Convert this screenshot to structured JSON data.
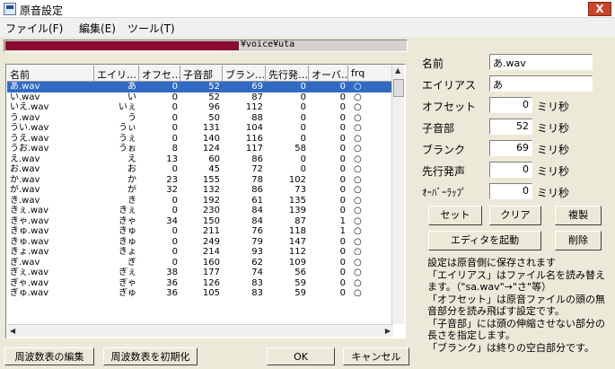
{
  "window": {
    "title": "原音設定",
    "close_label": "X"
  },
  "menu": [
    {
      "label": "ファイル(F)"
    },
    {
      "label": "編集(E)"
    },
    {
      "label": "ツール(T)"
    }
  ],
  "path": {
    "text": "¥voice¥uta",
    "accent": "#8b0a2e"
  },
  "table": {
    "headers": [
      "名前",
      "エイリ…",
      "オフセ…",
      "子音部",
      "ブラン…",
      "先行発…",
      "オーバ…",
      "frq"
    ],
    "rows": [
      [
        "あ.wav",
        "あ",
        "0",
        "52",
        "69",
        "0",
        "0",
        "○"
      ],
      [
        "い.wav",
        "い",
        "0",
        "52",
        "87",
        "0",
        "0",
        "○"
      ],
      [
        "いえ.wav",
        "いぇ",
        "0",
        "96",
        "112",
        "0",
        "0",
        "○"
      ],
      [
        "う.wav",
        "う",
        "0",
        "50",
        "88",
        "0",
        "0",
        "○"
      ],
      [
        "うい.wav",
        "うぃ",
        "0",
        "131",
        "104",
        "0",
        "0",
        "○"
      ],
      [
        "うえ.wav",
        "うぇ",
        "0",
        "140",
        "116",
        "0",
        "0",
        "○"
      ],
      [
        "うお.wav",
        "うぉ",
        "8",
        "124",
        "117",
        "58",
        "0",
        "○"
      ],
      [
        "え.wav",
        "え",
        "13",
        "60",
        "86",
        "0",
        "0",
        "○"
      ],
      [
        "お.wav",
        "お",
        "0",
        "45",
        "72",
        "0",
        "0",
        "○"
      ],
      [
        "か.wav",
        "か",
        "23",
        "155",
        "78",
        "102",
        "0",
        "○"
      ],
      [
        "が.wav",
        "が",
        "32",
        "132",
        "86",
        "73",
        "0",
        "○"
      ],
      [
        "き.wav",
        "き",
        "0",
        "192",
        "61",
        "135",
        "0",
        "○"
      ],
      [
        "きぇ.wav",
        "きぇ",
        "0",
        "230",
        "84",
        "139",
        "0",
        "○"
      ],
      [
        "きゃ.wav",
        "きゃ",
        "34",
        "150",
        "84",
        "87",
        "1",
        "○"
      ],
      [
        "きゅ.wav",
        "きゅ",
        "0",
        "211",
        "76",
        "118",
        "1",
        "○"
      ],
      [
        "きゅ.wav",
        "きゅ",
        "0",
        "249",
        "79",
        "147",
        "0",
        "○"
      ],
      [
        "きょ.wav",
        "きょ",
        "0",
        "214",
        "93",
        "112",
        "0",
        "○"
      ],
      [
        "ぎ.wav",
        "ぎ",
        "0",
        "160",
        "62",
        "109",
        "0",
        "○"
      ],
      [
        "ぎぇ.wav",
        "ぎぇ",
        "38",
        "177",
        "74",
        "56",
        "0",
        "○"
      ],
      [
        "ぎゃ.wav",
        "ぎゃ",
        "36",
        "126",
        "83",
        "59",
        "0",
        "○"
      ],
      [
        "ぎゅ.wav",
        "ぎゅ",
        "36",
        "105",
        "83",
        "59",
        "0",
        "○"
      ]
    ]
  },
  "form": {
    "name_label": "名前",
    "name_value": "あ.wav",
    "alias_label": "エイリアス",
    "alias_value": "あ",
    "offset_label": "オフセット",
    "offset_value": "0",
    "consonant_label": "子音部",
    "consonant_value": "52",
    "blank_label": "ブランク",
    "blank_value": "69",
    "preutter_label": "先行発声",
    "preutter_value": "0",
    "overlap_label": "ｵｰﾊﾞｰﾗｯﾌﾟ",
    "overlap_value": "0",
    "unit": "ミリ秒"
  },
  "buttons": {
    "set": "セット",
    "clear": "クリア",
    "copy": "複製",
    "editor": "エディタを起動",
    "delete": "削除",
    "edit_freq": "周波数表の編集",
    "init_freq": "周波数表を初期化",
    "ok": "OK",
    "cancel": "キャンセル"
  },
  "help": [
    "設定は原音側に保存されます",
    "「エイリアス」はファイル名を読み替えます。（\"sa.wav\"→\"さ\"等）",
    "「オフセット」は原音ファイルの頭の無音部分を読み飛ばす設定です。",
    "「子音部」には頭の伸縮させない部分の長さを指定します。",
    "「ブランク」は終りの空白部分です。"
  ],
  "colors": {
    "selection": "#316ac5",
    "window_bg": "#ece9d8"
  }
}
